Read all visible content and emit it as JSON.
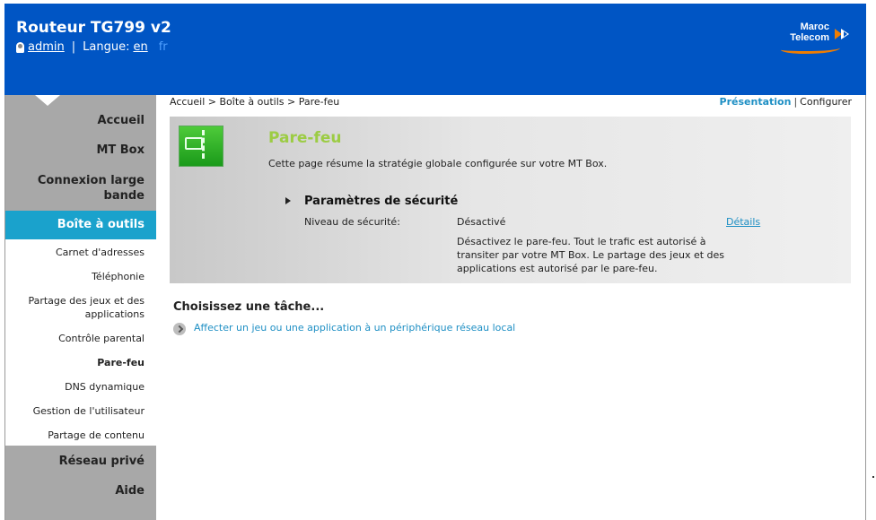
{
  "header": {
    "title": "Routeur TG799 v2",
    "user": "admin",
    "language_label": "Langue:",
    "lang_en": "en",
    "lang_fr": "fr",
    "logo_line1": "Maroc",
    "logo_line2": "Telecom"
  },
  "colors": {
    "header_bg": "#0055c4",
    "active_nav": "#1aa2cc",
    "accent_link": "#1e8fc4",
    "title_green": "#9ccc44",
    "sidebar_bg": "#a8a8a8"
  },
  "sidebar": {
    "items": [
      "Accueil",
      "MT Box",
      "Connexion large bande",
      "Boîte à outils",
      "Réseau privé",
      "Aide"
    ],
    "active": "Boîte à outils",
    "subitems": [
      "Carnet d'adresses",
      "Téléphonie",
      "Partage des jeux et des applications",
      "Contrôle parental",
      "Pare-feu",
      "DNS dynamique",
      "Gestion de l'utilisateur",
      "Partage de contenu"
    ],
    "current_subitem": "Pare-feu"
  },
  "breadcrumb": "Accueil > Boîte à outils > Pare-feu",
  "view": {
    "presentation": "Présentation",
    "configure": "Configurer"
  },
  "panel": {
    "title": "Pare-feu",
    "description": "Cette page résume la stratégie globale configurée sur votre MT Box.",
    "section_title": "Paramètres de sécurité",
    "level_label": "Niveau de sécurité:",
    "level_value": "Désactivé",
    "details_link": "Détails",
    "level_note": "Désactivez le pare-feu. Tout le trafic est autorisé à transiter par votre MT Box. Le partage des jeux et des applications est autorisé par le pare-feu."
  },
  "tasks": {
    "title": "Choisissez une tâche...",
    "items": [
      "Affecter un jeu ou une application à un périphérique réseau local"
    ]
  },
  "icons": [
    "user-icon",
    "maroc-telecom-logo",
    "firewall-icon",
    "expand-arrow-icon",
    "task-chevron-icon"
  ]
}
